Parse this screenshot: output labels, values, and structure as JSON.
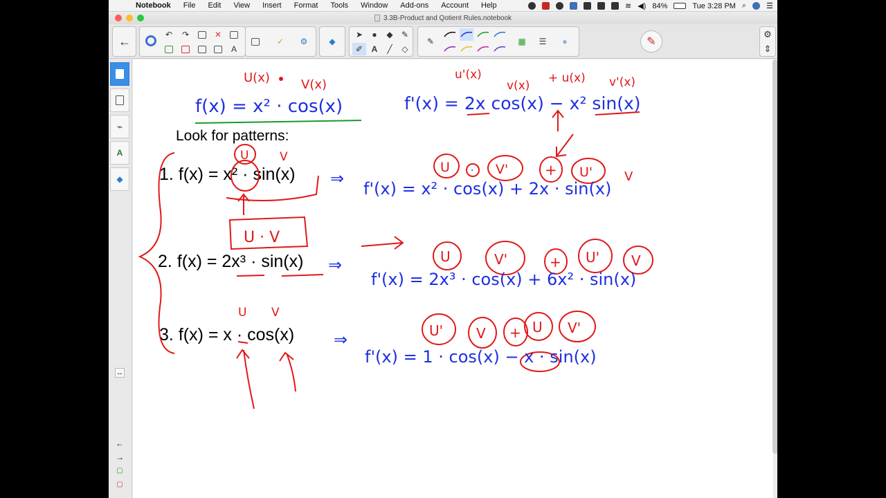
{
  "menubar": {
    "app_name": "Notebook",
    "items": [
      "File",
      "Edit",
      "View",
      "Insert",
      "Format",
      "Tools",
      "Window",
      "Add-ons",
      "Account",
      "Help"
    ],
    "battery": "84%",
    "clock": "Tue 3:28 PM"
  },
  "window": {
    "title": "3.3B-Product and Qotient Rules.notebook"
  },
  "page": {
    "heading": "Look for patterns:",
    "problems": [
      {
        "num": "1.",
        "text": "f(x) = x² · sin(x)"
      },
      {
        "num": "2.",
        "text": "f(x) = 2x³ · sin(x)"
      },
      {
        "num": "3.",
        "text": "f(x) = x · cos(x)"
      }
    ]
  },
  "ink": {
    "top_left": {
      "u_label": "U(x)",
      "v_label": "V(x)",
      "expr": "f(x) = x² · cos(x)"
    },
    "top_right": {
      "labels": [
        "u'(x)",
        "v(x)",
        "+ u(x)",
        "v'(x)"
      ],
      "expr": "f'(x) = 2x cos(x) − x² sin(x)"
    },
    "p1": {
      "labels": [
        "U",
        "V",
        "U",
        "V'",
        "+",
        "U'",
        "V"
      ],
      "dot": "·",
      "arrow": "⇒",
      "answer": "f'(x) = x² · cos(x) + 2x · sin(x)"
    },
    "p2": {
      "box": "U · V",
      "arrow": "⇒",
      "labels": [
        "U",
        "V'",
        "+",
        "U'",
        "V"
      ],
      "answer": "f'(x) = 2x³ · cos(x) + 6x² · sin(x)"
    },
    "p3": {
      "labels_small": [
        "U",
        "V"
      ],
      "arrow": "⇒",
      "labels": [
        "U'",
        "V",
        "+",
        "U",
        "V'"
      ],
      "answer": "f'(x) = 1 · cos(x) − x · sin(x)"
    }
  },
  "colors": {
    "ink_blue": "#1e2fe0",
    "ink_red": "#e01818",
    "ink_green": "#1a9a2a",
    "sidebar_active": "#3b8fe4"
  }
}
